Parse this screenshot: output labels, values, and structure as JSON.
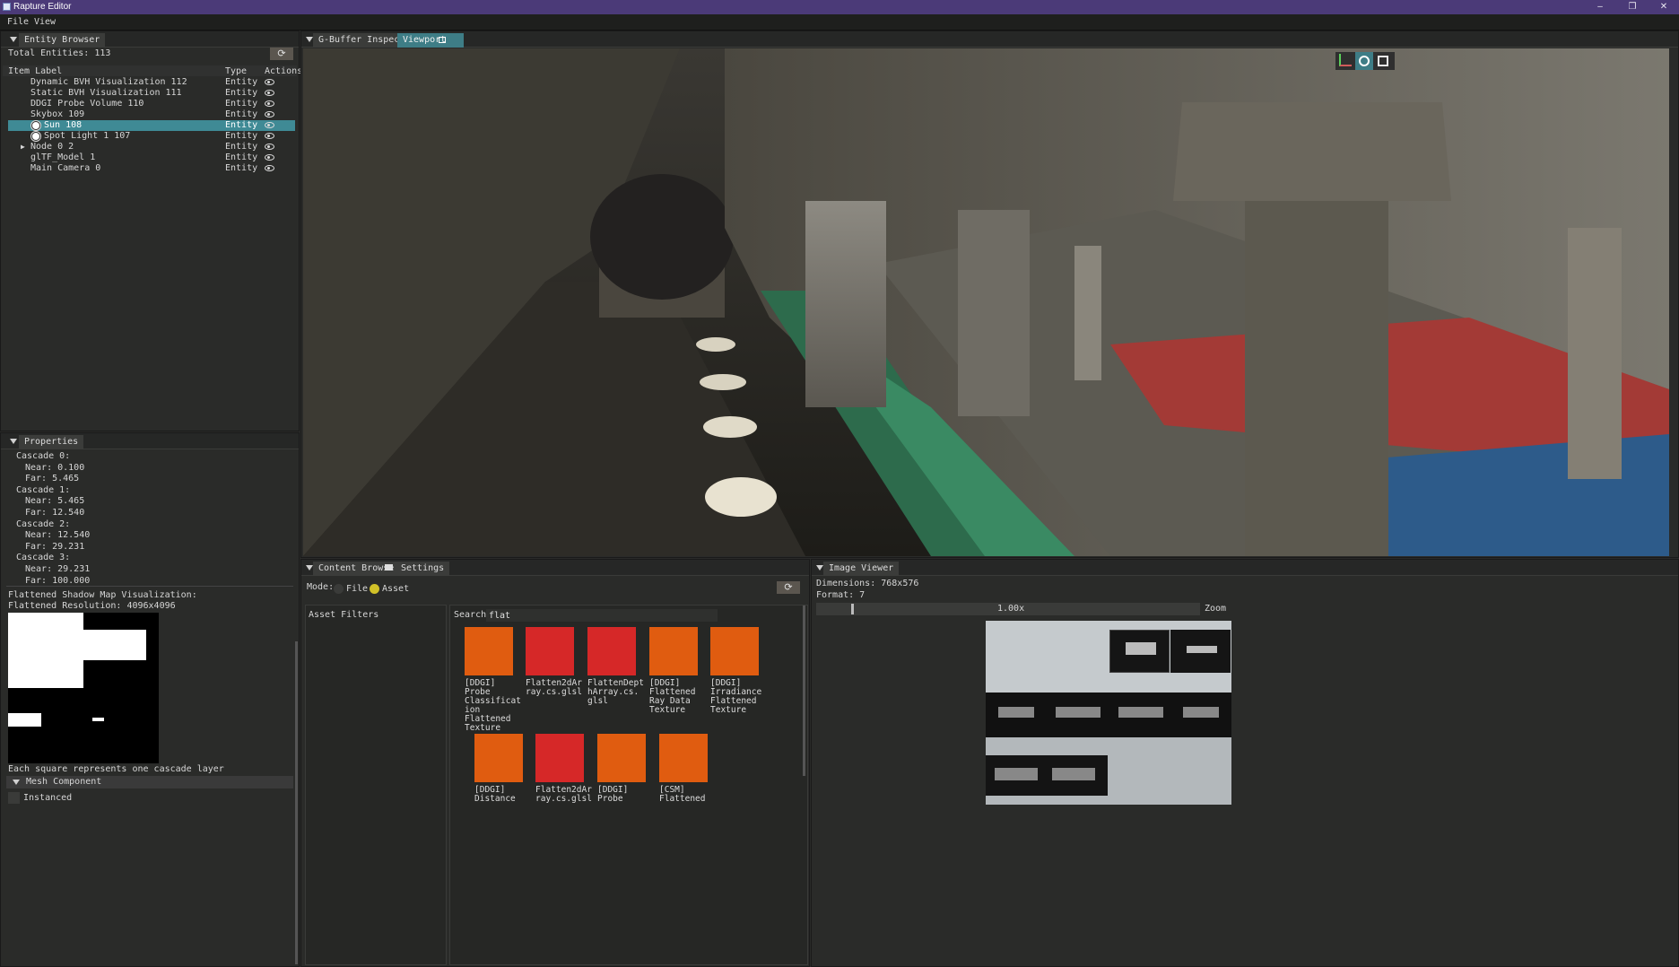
{
  "window": {
    "title": "Rapture Editor",
    "minimize": "–",
    "restore": "❐",
    "close": "✕"
  },
  "menu": {
    "file": "File",
    "view": "View"
  },
  "entity_browser": {
    "tab": "Entity Browser",
    "total_label": "Total Entities: 113",
    "refresh_icon": "⟳",
    "columns": {
      "label": "Item Label",
      "type": "Type",
      "actions": "Actions"
    },
    "rows": [
      {
        "label": "Dynamic BVH Visualization 112",
        "type": "Entity"
      },
      {
        "label": "Static BVH Visualization 111",
        "type": "Entity"
      },
      {
        "label": "DDGI Probe Volume 110",
        "type": "Entity"
      },
      {
        "label": "Skybox 109",
        "type": "Entity"
      },
      {
        "label": "Sun 108",
        "type": "Entity"
      },
      {
        "label": "Spot Light 1 107",
        "type": "Entity"
      },
      {
        "label": "Node 0 2",
        "type": "Entity"
      },
      {
        "label": "glTF_Model 1",
        "type": "Entity"
      },
      {
        "label": "Main Camera 0",
        "type": "Entity"
      }
    ]
  },
  "properties": {
    "tab": "Properties",
    "cascades": [
      {
        "title": "Cascade 0:",
        "near": "Near: 0.100",
        "far": "Far: 5.465"
      },
      {
        "title": "Cascade 1:",
        "near": "Near: 5.465",
        "far": "Far: 12.540"
      },
      {
        "title": "Cascade 2:",
        "near": "Near: 12.540",
        "far": "Far: 29.231"
      },
      {
        "title": "Cascade 3:",
        "near": "Near: 29.231",
        "far": "Far: 100.000"
      }
    ],
    "shadow_title": "Flattened Shadow Map Visualization:",
    "shadow_res": "Flattened Resolution: 4096x4096",
    "shadow_note": "Each square represents one cascade layer",
    "mesh_component": "Mesh Component",
    "instanced": "Instanced"
  },
  "viewport": {
    "tab_inactive": "G-Buffer Inspector",
    "tab_active": "Viewport"
  },
  "content_browser": {
    "tab": "Content Browser",
    "tab2": "Settings",
    "mode_label": "Mode:",
    "mode_file": "File",
    "mode_asset": "Asset",
    "refresh_icon": "⟳",
    "filters_title": "Asset Filters",
    "search_label": "Search:",
    "search_value": "flat",
    "assets_row1": [
      {
        "caption": "[DDGI]\nProbe\nClassificat\nion\nFlattened\nTexture",
        "color": "#e05c10"
      },
      {
        "caption": "Flatten2dAr\nray.cs.glsl",
        "color": "#d62828"
      },
      {
        "caption": "FlattenDept\nhArray.cs.\nglsl",
        "color": "#d62828"
      },
      {
        "caption": "[DDGI]\nFlattened\nRay Data\nTexture",
        "color": "#e05c10"
      },
      {
        "caption": "[DDGI]\nIrradiance\nFlattened\nTexture",
        "color": "#e05c10"
      }
    ],
    "assets_row2": [
      {
        "caption": "[DDGI]\nDistance",
        "color": "#e05c10"
      },
      {
        "caption": "Flatten2dAr\nray.cs.glsl",
        "color": "#d62828"
      },
      {
        "caption": "[DDGI]\nProbe",
        "color": "#e05c10"
      },
      {
        "caption": "[CSM]\nFlattened",
        "color": "#e05c10"
      }
    ]
  },
  "image_viewer": {
    "tab": "Image Viewer",
    "dimensions": "Dimensions: 768x576",
    "format": "Format: 7",
    "zoom_value": "1.00x",
    "zoom_label": "Zoom"
  },
  "colors": {
    "accent": "#3e7d86",
    "title_bar": "#4b3a78",
    "asset_orange": "#e05c10",
    "asset_red": "#d62828"
  }
}
